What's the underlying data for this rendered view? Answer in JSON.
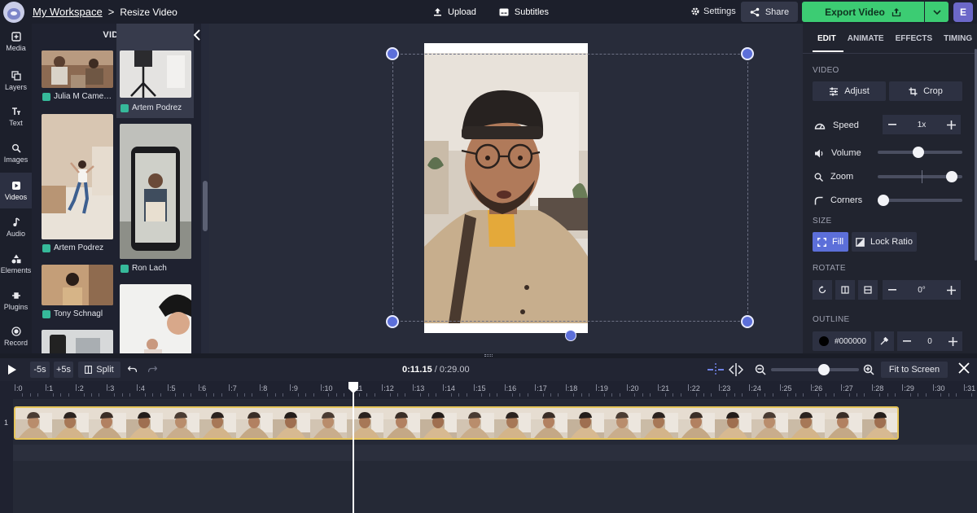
{
  "topbar": {
    "workspace": "My Workspace",
    "separator": ">",
    "page": "Resize Video",
    "upload": "Upload",
    "subtitles": "Subtitles",
    "settings": "Settings",
    "share": "Share",
    "export": "Export Video",
    "user_initial": "E"
  },
  "nav": {
    "items": [
      {
        "label": "Media",
        "icon": "media-icon"
      },
      {
        "label": "Layers",
        "icon": "layers-icon"
      },
      {
        "label": "Text",
        "icon": "text-icon"
      },
      {
        "label": "Images",
        "icon": "images-icon"
      },
      {
        "label": "Videos",
        "icon": "videos-icon",
        "active": true
      },
      {
        "label": "Audio",
        "icon": "audio-icon"
      },
      {
        "label": "Elements",
        "icon": "elements-icon"
      },
      {
        "label": "Plugins",
        "icon": "plugins-icon"
      },
      {
        "label": "Record",
        "icon": "record-icon"
      }
    ]
  },
  "library": {
    "title": "VIDEOS",
    "clips": [
      "Julia M Came…",
      "Artem Podrez",
      "Artem Podrez",
      "Ron Lach",
      "Tony Schnagl"
    ]
  },
  "panel": {
    "tabs": [
      "EDIT",
      "ANIMATE",
      "EFFECTS",
      "TIMING"
    ],
    "video_section": "VIDEO",
    "adjust": "Adjust",
    "crop": "Crop",
    "speed_label": "Speed",
    "speed_value": "1x",
    "volume_label": "Volume",
    "volume_level": 0.48,
    "zoom_label": "Zoom",
    "zoom_level": 0.93,
    "corners_label": "Corners",
    "corners_level": 0.0,
    "size_section": "SIZE",
    "fill": "Fill",
    "lock_ratio": "Lock Ratio",
    "rotate_section": "ROTATE",
    "rotate_value": "0°",
    "outline_section": "OUTLINE",
    "outline_color": "#000000",
    "outline_value": "0"
  },
  "timeline": {
    "minus5": "-5s",
    "plus5": "+5s",
    "split": "Split",
    "current": "0:11.15",
    "total": "/ 0:29.00",
    "fit": "Fit to Screen",
    "zoom_level": 0.62,
    "track_number": "1",
    "ticks": [
      ":0",
      ":1",
      ":2",
      ":3",
      ":4",
      ":5",
      ":6",
      ":7",
      ":8",
      ":9",
      ":10",
      ":11",
      ":12",
      ":13",
      ":14",
      ":15",
      ":16",
      ":17",
      ":18",
      ":19",
      ":20",
      ":21",
      ":22",
      ":23",
      ":24",
      ":25",
      ":26",
      ":27",
      ":28",
      ":29",
      ":30",
      ":31"
    ]
  },
  "colors": {
    "accent": "#5c6fd9",
    "export": "#3ccc73",
    "clip_border": "#e6c55a",
    "badge": "#36b99a"
  }
}
